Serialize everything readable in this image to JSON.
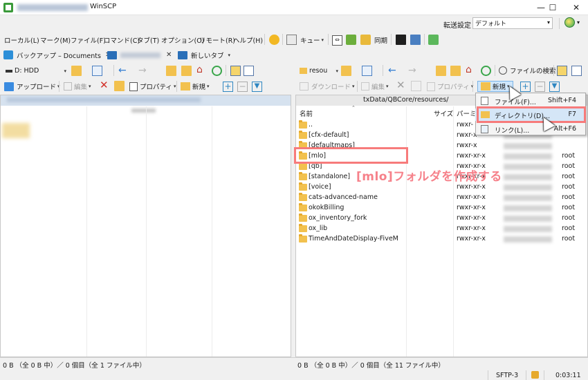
{
  "window": {
    "title": "WinSCP",
    "minimize_glyph": "—",
    "maximize_glyph": "☐",
    "close_glyph": "✕"
  },
  "transfer": {
    "label": "転送設定",
    "value": "デフォルト"
  },
  "menu": {
    "items": [
      "ローカル(L)",
      "マーク(M)",
      "ファイル(F)",
      "コマンド(C)",
      "タブ(T)",
      "オプション(O)",
      "リモート(R)",
      "ヘルプ(H)"
    ],
    "queue_label": "キュー",
    "sync_label": "同期"
  },
  "tabs": {
    "backup_label": "バックアップ – Documents",
    "new_tab_label": "新しいタブ",
    "close_glyph": "✕"
  },
  "left_toolbar": {
    "drive_label": "D: HDD",
    "upload_label": "アップロード",
    "edit_label": "編集",
    "properties_label": "プロパティ",
    "new_label": "新規"
  },
  "right_toolbar": {
    "dir_label": "resou",
    "find_label": "ファイルの検索",
    "download_label": "ダウンロード",
    "edit_label": "編集",
    "properties_label": "プロパティ",
    "new_label": "新規"
  },
  "right_panel": {
    "path": "txData/QBCore/resources/",
    "columns": {
      "name": "名前",
      "size": "サイズ",
      "perm": "パーミッ"
    },
    "rows": [
      {
        "name": "..",
        "perm": "rwxr-",
        "owner": ""
      },
      {
        "name": "[cfx-default]",
        "perm": "rwxr-x",
        "owner": ""
      },
      {
        "name": "[defaultmaps]",
        "perm": "rwxr-x",
        "owner": ""
      },
      {
        "name": "[mlo]",
        "perm": "rwxr-xr-x",
        "owner": "root"
      },
      {
        "name": "[qb]",
        "perm": "rwxr-xr-x",
        "owner": "root"
      },
      {
        "name": "[standalone]",
        "perm": "rwxr-xr-x",
        "owner": "root"
      },
      {
        "name": "[voice]",
        "perm": "rwxr-xr-x",
        "owner": "root"
      },
      {
        "name": "cats-advanced-name",
        "perm": "rwxr-xr-x",
        "owner": "root"
      },
      {
        "name": "okokBilling",
        "perm": "rwxr-xr-x",
        "owner": "root"
      },
      {
        "name": "ox_inventory_fork",
        "perm": "rwxr-xr-x",
        "owner": "root"
      },
      {
        "name": "ox_lib",
        "perm": "rwxr-xr-x",
        "owner": "root"
      },
      {
        "name": "TimeAndDateDisplay-FiveM",
        "perm": "rwxr-xr-x",
        "owner": "root"
      }
    ]
  },
  "context_menu": {
    "items": [
      {
        "label": "ファイル(F)...",
        "shortcut": "Shift+F4"
      },
      {
        "label": "ディレクトリ(D)...",
        "shortcut": "F7"
      },
      {
        "label": "リンク(L)...",
        "shortcut": "Alt+F6"
      }
    ]
  },
  "annotation": "[mlo]フォルダを作成する",
  "status": {
    "left": "0 B （全 0 B 中）／ 0 個目（全 1 ファイル中）",
    "right": "0 B （全 0 B 中）／ 0 個目（全 11 ファイル中）",
    "protocol": "SFTP-3",
    "time": "0:03:11"
  },
  "colors": {
    "highlight": "#f77b7b",
    "annotation": "#f6818a",
    "folder": "#f2c14e"
  }
}
